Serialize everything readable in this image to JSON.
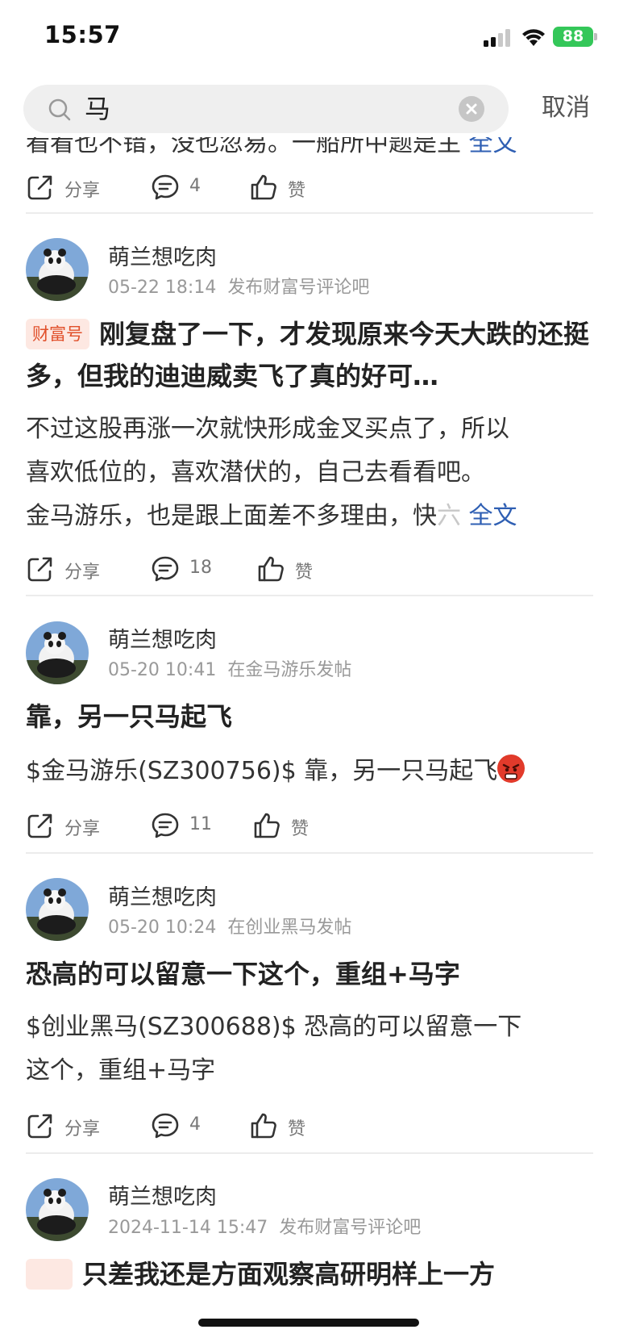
{
  "status_bar": {
    "time": "15:57",
    "battery": "88"
  },
  "search": {
    "query": "马",
    "cancel_label": "取消"
  },
  "clip": {
    "text": "看看也不错，没也忽易。一船所中题是主",
    "fulltext": "全文",
    "share": "分享",
    "comments": "4",
    "like": "赞"
  },
  "posts": [
    {
      "author": "萌兰想吃肉",
      "date": "05-22 18:14",
      "source": "发布财富号评论吧",
      "badge": "财富号",
      "title": "刚复盘了一下，才发现原来今天大跌的还挺多，但我的迪迪威卖飞了真的好可…",
      "body_lines": [
        "不过这股再涨一次就快形成金叉买点了，所以",
        "喜欢低位的，喜欢潜伏的，自己去看看吧。",
        "金马游乐，也是跟上面差不多理由，快"
      ],
      "body_fade": "六",
      "fulltext": "全文",
      "share": "分享",
      "comments": "18",
      "like": "赞"
    },
    {
      "author": "萌兰想吃肉",
      "date": "05-20 10:41",
      "source": "在金马游乐发帖",
      "title": "靠，另一只马起飞",
      "body_lines": [
        "$金马游乐(SZ300756)$ 靠，另一只马起飞"
      ],
      "share": "分享",
      "comments": "11",
      "like": "赞"
    },
    {
      "author": "萌兰想吃肉",
      "date": "05-20 10:24",
      "source": "在创业黑马发帖",
      "title": "恐高的可以留意一下这个，重组+马字",
      "body_lines": [
        "$创业黑马(SZ300688)$ 恐高的可以留意一下",
        "这个，重组+马字"
      ],
      "share": "分享",
      "comments": "4",
      "like": "赞"
    },
    {
      "author": "萌兰想吃肉",
      "date": "2024-11-14 15:47",
      "source": "发布财富号评论吧",
      "title": "只差我还是方面观察高研明样上一方"
    }
  ]
}
